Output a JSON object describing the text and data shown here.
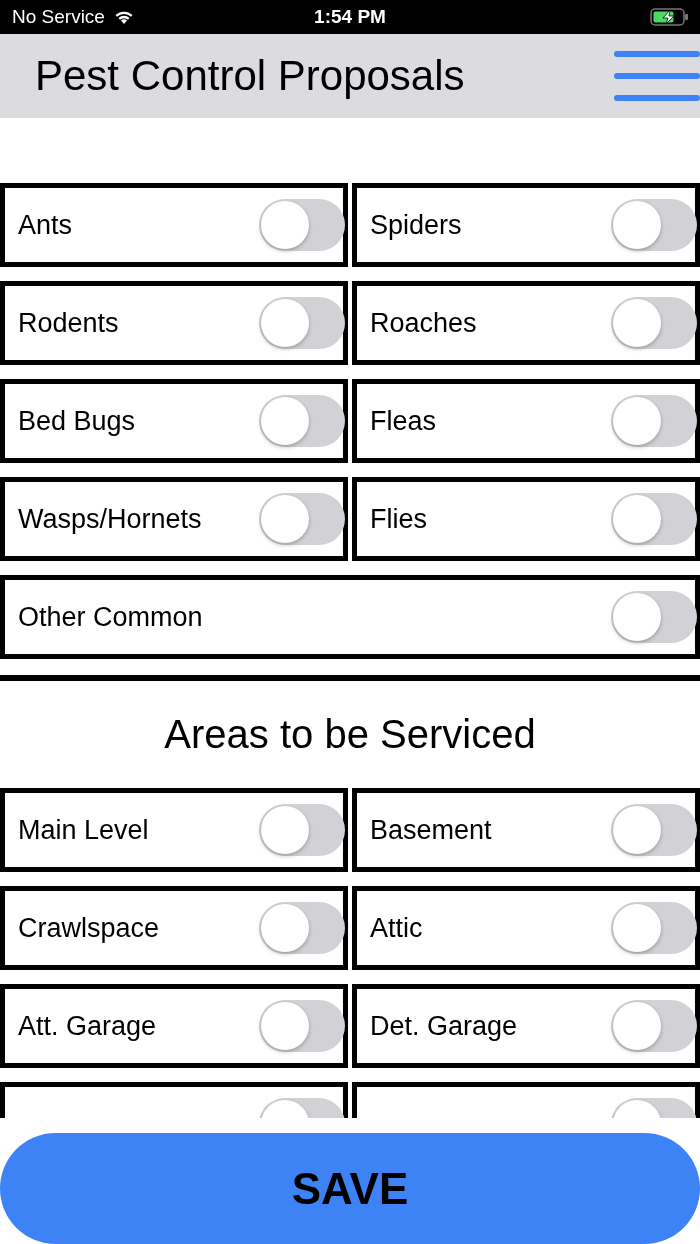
{
  "status_bar": {
    "carrier": "No Service",
    "time": "1:54 PM",
    "charging": true
  },
  "header": {
    "title": "Pest Control Proposals"
  },
  "pests": [
    {
      "label": "Ants",
      "on": false
    },
    {
      "label": "Spiders",
      "on": false
    },
    {
      "label": "Rodents",
      "on": false
    },
    {
      "label": "Roaches",
      "on": false
    },
    {
      "label": "Bed Bugs",
      "on": false
    },
    {
      "label": "Fleas",
      "on": false
    },
    {
      "label": "Wasps/Hornets",
      "on": false
    },
    {
      "label": "Flies",
      "on": false
    },
    {
      "label": "Other Common",
      "on": false,
      "kind": "wide"
    }
  ],
  "areas": {
    "heading": "Areas to be Serviced",
    "items": [
      {
        "label": "Main Level",
        "on": false
      },
      {
        "label": "Basement",
        "on": false
      },
      {
        "label": "Crawlspace",
        "on": false
      },
      {
        "label": "Attic",
        "on": false
      },
      {
        "label": "Att. Garage",
        "on": false
      },
      {
        "label": "Det. Garage",
        "on": false
      },
      {
        "on": false
      },
      {
        "on": false
      }
    ]
  },
  "save_button": {
    "label": "SAVE"
  }
}
